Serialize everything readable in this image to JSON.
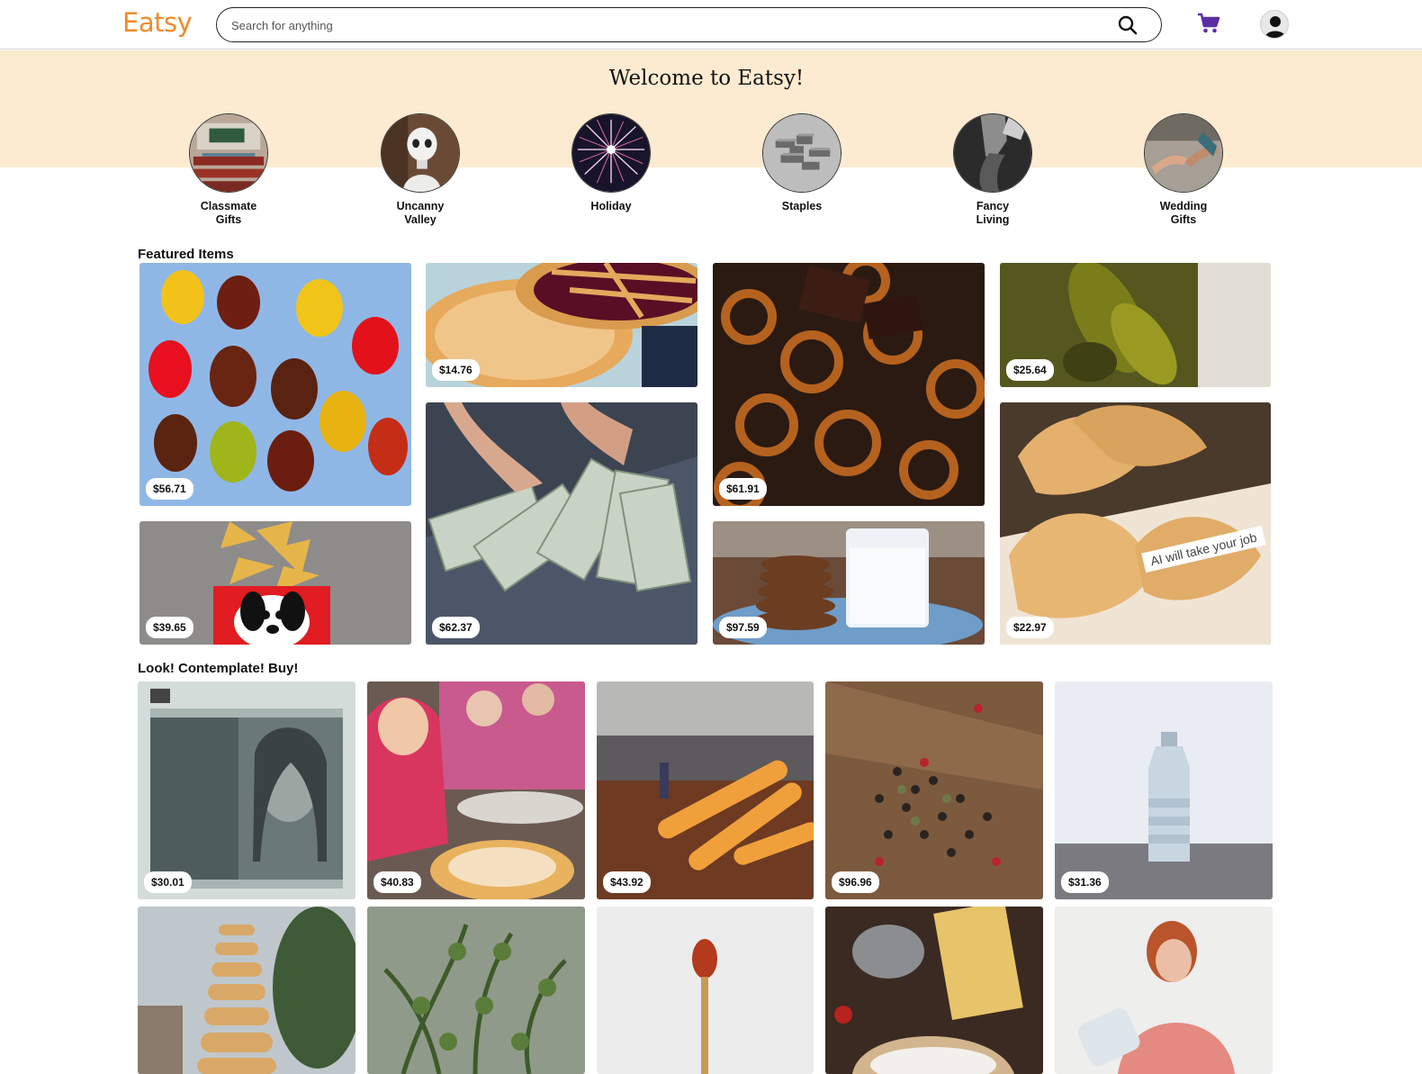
{
  "brand": {
    "name": "Eatsy",
    "color": "#ef8a2a"
  },
  "search": {
    "placeholder": "Search for anything"
  },
  "icons": {
    "search": "search-icon",
    "cart": "cart-icon",
    "account": "user-icon"
  },
  "colors": {
    "hero_bg": "#fdebd1",
    "cart": "#5b2ea6"
  },
  "hero": {
    "title": "Welcome to Eatsy!"
  },
  "categories": [
    {
      "line1": "Classmate",
      "line2": "Gifts"
    },
    {
      "line1": "Uncanny",
      "line2": "Valley"
    },
    {
      "line1": "Holiday",
      "line2": ""
    },
    {
      "line1": "Staples",
      "line2": ""
    },
    {
      "line1": "Fancy",
      "line2": "Living"
    },
    {
      "line1": "Wedding",
      "line2": "Gifts"
    }
  ],
  "featured": {
    "title": "Featured Items",
    "items": [
      {
        "price": "$56.71",
        "subject": "gummy bears"
      },
      {
        "price": "$14.76",
        "subject": "pie"
      },
      {
        "price": "$61.91",
        "subject": "chocolate pretzels"
      },
      {
        "price": "$25.64",
        "subject": "pickles"
      },
      {
        "price": "$39.65",
        "subject": "chips"
      },
      {
        "price": "$62.37",
        "subject": "cash"
      },
      {
        "price": "$97.59",
        "subject": "cookies and milk"
      },
      {
        "price": "$22.97",
        "subject": "fortune cookies",
        "note": "AI will take your job"
      }
    ]
  },
  "browse": {
    "title": "Look! Contemplate! Buy!",
    "items": [
      {
        "price": "$30.01"
      },
      {
        "price": "$40.83"
      },
      {
        "price": "$43.92"
      },
      {
        "price": "$96.96"
      },
      {
        "price": "$31.36"
      },
      {
        "price": ""
      },
      {
        "price": ""
      },
      {
        "price": ""
      },
      {
        "price": ""
      },
      {
        "price": ""
      }
    ]
  }
}
